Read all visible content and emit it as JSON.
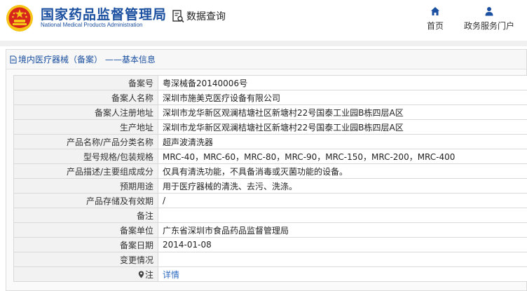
{
  "header": {
    "logo_cn": "国家药品监督管理局",
    "logo_en": "National Medical Products Administration",
    "query_label": "数据查询",
    "nav": [
      {
        "label": "首页",
        "icon": "home-icon"
      },
      {
        "label": "政务服务门户",
        "icon": "user-icon"
      }
    ]
  },
  "panel": {
    "title": "境内医疗器械（备案） ——基本信息",
    "rows": [
      {
        "label": "备案号",
        "value": "粤深械备20140006号"
      },
      {
        "label": "备案人名称",
        "value": "深圳市施美克医疗设备有限公司"
      },
      {
        "label": "备案人注册地址",
        "value": "深圳市龙华新区观澜桔塘社区新塘村22号国泰工业园B栋四层A区"
      },
      {
        "label": "生产地址",
        "value": "深圳市龙华新区观澜桔塘社区新塘村22号国泰工业园B栋四层A区"
      },
      {
        "label": "产品名称/产品分类名称",
        "value": "超声波清洗器"
      },
      {
        "label": "型号规格/包装规格",
        "value": "MRC-40，MRC-60，MRC-80，MRC-90，MRC-150，MRC-200，MRC-400"
      },
      {
        "label": "产品描述/主要组成成分",
        "value": "仅具有清洗功能，不具备消毒或灭菌功能的设备。"
      },
      {
        "label": "预期用途",
        "value": "用于医疗器械的清洗、去污、洗涤。"
      },
      {
        "label": "产品存储及有效期",
        "value": "/"
      },
      {
        "label": "备注",
        "value": ""
      },
      {
        "label": "备案单位",
        "value": "广东省深圳市食品药品监督管理局"
      },
      {
        "label": "备案日期",
        "value": "2014-01-08"
      },
      {
        "label": "变更情况",
        "value": ""
      },
      {
        "label": "注",
        "value": "详情"
      }
    ]
  },
  "colors": {
    "brand_blue": "#1b4fa0",
    "link_blue": "#2d6ac0",
    "label_bg": "#f2f2f2",
    "emblem_red": "#d7261c",
    "emblem_gold": "#f5c518"
  }
}
